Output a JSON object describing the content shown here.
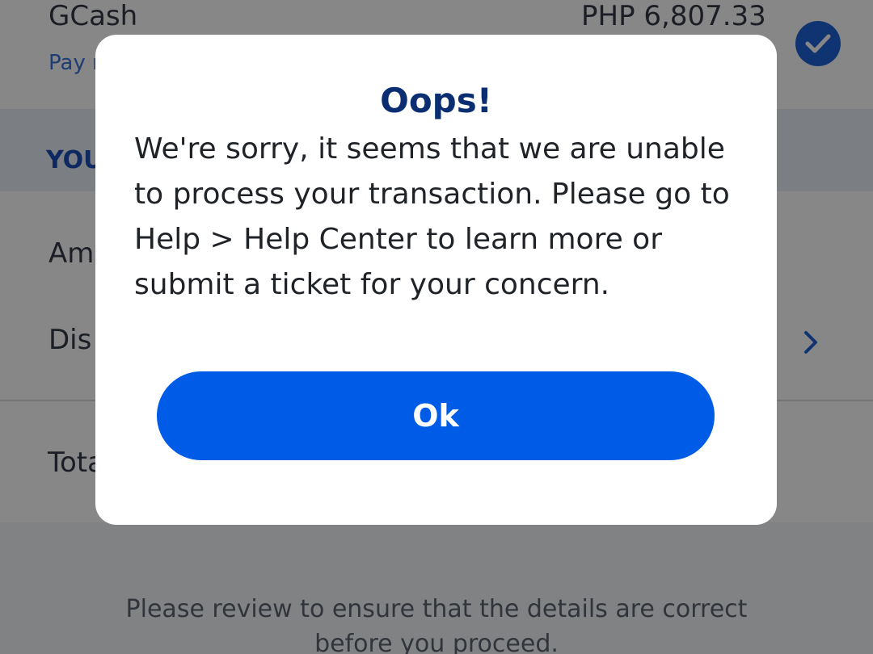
{
  "background": {
    "wallet": {
      "name": "GCash",
      "balance": "PHP 6,807.33",
      "pay_link": "Pay r"
    },
    "section_title": "YOU",
    "rows": {
      "amount_label": "Am",
      "discount_label": "Dis",
      "total_label": "Tota"
    },
    "footer_note": "Please review to ensure that the details are correct before you proceed."
  },
  "dialog": {
    "title": "Oops!",
    "message": "We're sorry, it seems that we are unable to process your transaction. Please go to Help > Help Center to learn more or submit a ticket for your concern.",
    "ok_label": "Ok"
  },
  "colors": {
    "primary_button": "#005ce6",
    "title_navy": "#0b2e72",
    "link_blue": "#3a73d8",
    "check_blue": "#1f63d6"
  },
  "icons": {
    "selected_check": "check-circle-icon",
    "row_chevron": "chevron-right-icon"
  }
}
